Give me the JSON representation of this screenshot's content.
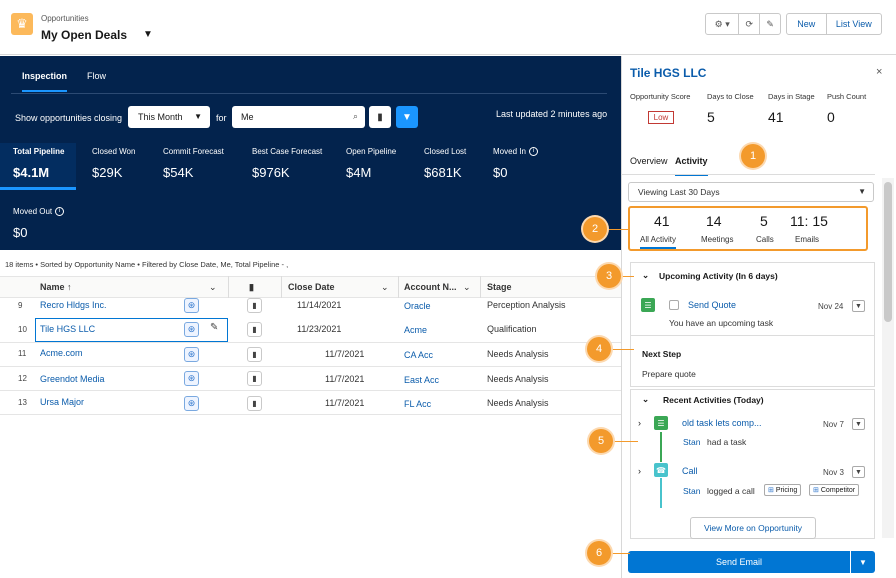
{
  "header": {
    "object_label": "Opportunities",
    "view_name": "My Open Deals",
    "chevron": "▼",
    "toolbar": {
      "gear": "⚙ ▾",
      "refresh": "⟳",
      "edit": "✎",
      "new_label": "New",
      "list_view_label": "List View"
    }
  },
  "dashboard": {
    "tabs": [
      "Inspection",
      "Flow"
    ],
    "filter_label": "Show opportunities closing",
    "period_value": "This Month",
    "for_label": "for",
    "owner_value": "Me",
    "last_updated": "Last updated 2 minutes ago",
    "kpis": [
      {
        "label": "Total Pipeline",
        "value": "$4.1M"
      },
      {
        "label": "Closed Won",
        "value": "$29K"
      },
      {
        "label": "Commit Forecast",
        "value": "$54K"
      },
      {
        "label": "Best Case Forecast",
        "value": "$976K"
      },
      {
        "label": "Open Pipeline",
        "value": "$4M"
      },
      {
        "label": "Closed Lost",
        "value": "$681K"
      },
      {
        "label": "Moved In",
        "value": "$0"
      },
      {
        "label": "Moved Out",
        "value": "$0"
      }
    ]
  },
  "table": {
    "summary": "18 items • Sorted by Opportunity Name • Filtered by Close Date, Me, Total Pipeline - ,",
    "headers": {
      "name": "Name ↑",
      "close_date": "Close Date",
      "account": "Account N...",
      "stage": "Stage"
    },
    "rows": [
      {
        "num": "9",
        "name": "Recro Hldgs Inc.",
        "close_date": "11/14/2021",
        "account": "Oracle",
        "stage": "Perception Analysis"
      },
      {
        "num": "10",
        "name": "Tile HGS LLC",
        "close_date": "11/23/2021",
        "account": "Acme",
        "stage": "Qualification"
      },
      {
        "num": "11",
        "name": "Acme.com",
        "close_date": "11/7/2021",
        "account": "CA Acc",
        "stage": "Needs Analysis"
      },
      {
        "num": "12",
        "name": "Greendot Media",
        "close_date": "11/7/2021",
        "account": "East Acc",
        "stage": "Needs Analysis"
      },
      {
        "num": "13",
        "name": "Ursa Major",
        "close_date": "11/7/2021",
        "account": "FL Acc",
        "stage": "Needs Analysis"
      }
    ]
  },
  "panel": {
    "title": "Tile HGS LLC",
    "close": "×",
    "metrics": [
      {
        "label": "Opportunity Score",
        "value": "Low"
      },
      {
        "label": "Days to Close",
        "value": "5"
      },
      {
        "label": "Days in Stage",
        "value": "41"
      },
      {
        "label": "Push Count",
        "value": "0"
      }
    ],
    "tabs": [
      "Overview",
      "Activity"
    ],
    "viewing": "Viewing Last 30 Days",
    "stats": [
      {
        "n": "41",
        "label": "All Activity"
      },
      {
        "n": "14",
        "label": "Meetings"
      },
      {
        "n": "5",
        "label": "Calls"
      },
      {
        "n": "11: 15",
        "label": "Emails"
      }
    ],
    "upcoming_header": "Upcoming Activity (In 6 days)",
    "upcoming_task": {
      "title": "Send Quote",
      "date": "Nov 24",
      "desc": "You have an upcoming task"
    },
    "next_step_label": "Next Step",
    "next_step_value": "Prepare quote",
    "recent_header": "Recent Activities (Today)",
    "recent": [
      {
        "title": "old task lets comp...",
        "date": "Nov 7",
        "user": "Stan",
        "desc": "had a task"
      },
      {
        "title": "Call",
        "date": "Nov 3",
        "user": "Stan",
        "desc": "logged a call",
        "tags": [
          "Pricing",
          "Competitor"
        ]
      }
    ],
    "view_more": "View More on Opportunity",
    "send_email": "Send Email"
  },
  "callouts": [
    "1",
    "2",
    "3",
    "4",
    "5",
    "6"
  ],
  "colors": {
    "navy": "#03234d",
    "brand": "#0176d3",
    "callout": "#f39a2c",
    "task_green": "#3ba755",
    "call_teal": "#48c3cc"
  }
}
